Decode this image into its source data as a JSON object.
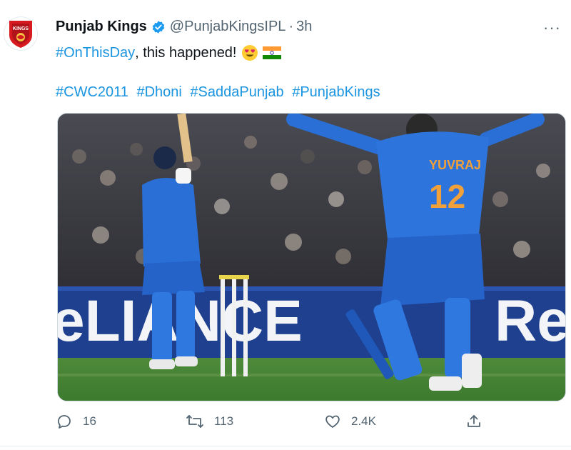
{
  "tweet": {
    "author_name": "Punjab Kings",
    "handle": "@PunjabKingsIPL",
    "separator": "·",
    "time": "3h",
    "more_label": "···",
    "line1": {
      "hashtag": "#OnThisDay",
      "text": ", this happened!"
    },
    "hashtags": [
      "#CWC2011",
      "#Dhoni",
      "#SaddaPunjab",
      "#PunjabKings"
    ],
    "avatar_text": "KINGS",
    "media": {
      "banner_text": "eLIANCE",
      "banner_text_right": "Re",
      "jersey_name": "YUVRAJ",
      "jersey_number": "12"
    },
    "actions": {
      "replies": "16",
      "retweets": "113",
      "likes": "2.4K"
    }
  },
  "colors": {
    "link": "#1b95e0",
    "muted": "#536471",
    "verified": "#1d9bf0",
    "brand_red": "#d71920"
  }
}
